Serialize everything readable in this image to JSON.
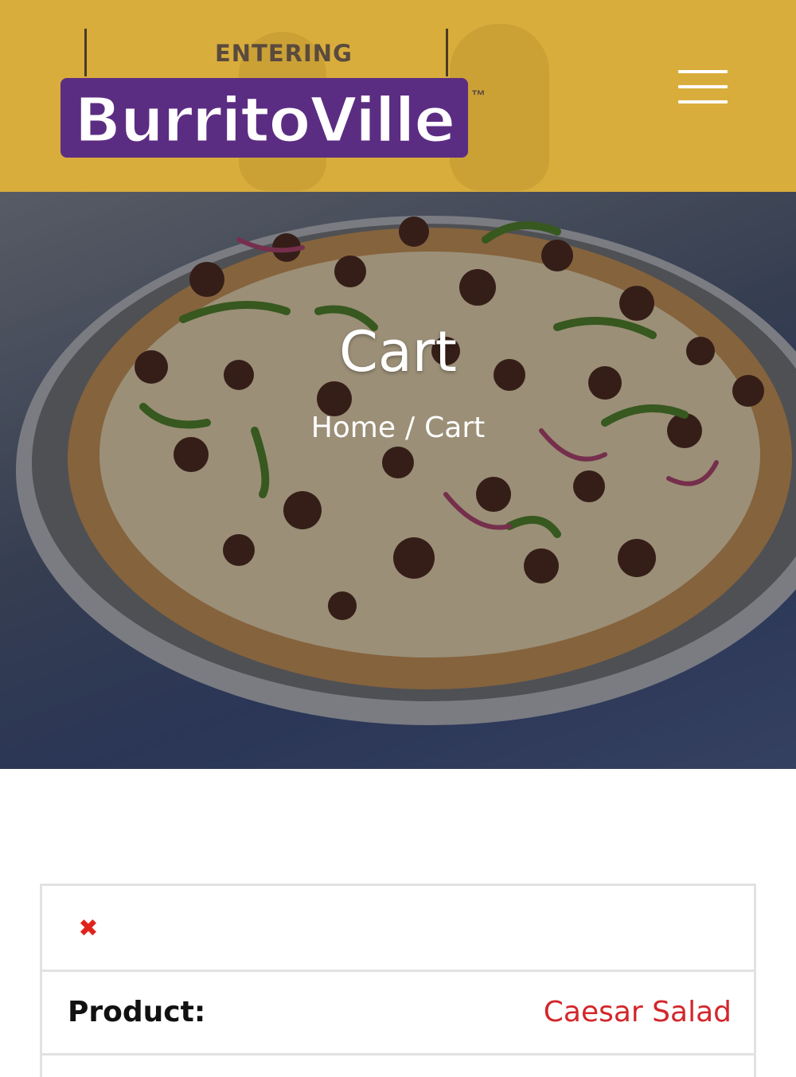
{
  "header": {
    "logo": {
      "entering_text": "ENTERING",
      "brand_text": "BurritoVille",
      "trademark": "™"
    },
    "menu_icon": "hamburger-menu-icon"
  },
  "hero": {
    "title": "Cart",
    "breadcrumb": {
      "home_label": "Home",
      "separator": "/",
      "current_label": "Cart"
    }
  },
  "cart": {
    "remove_icon": "close-icon",
    "remove_symbol": "✖",
    "product_label": "Product:",
    "product_name": "Caesar Salad"
  },
  "colors": {
    "header_bg": "#d8ad3c",
    "brand_purple": "#5b2d82",
    "accent_red": "#d3272b",
    "border_gray": "#e2e2e2"
  }
}
